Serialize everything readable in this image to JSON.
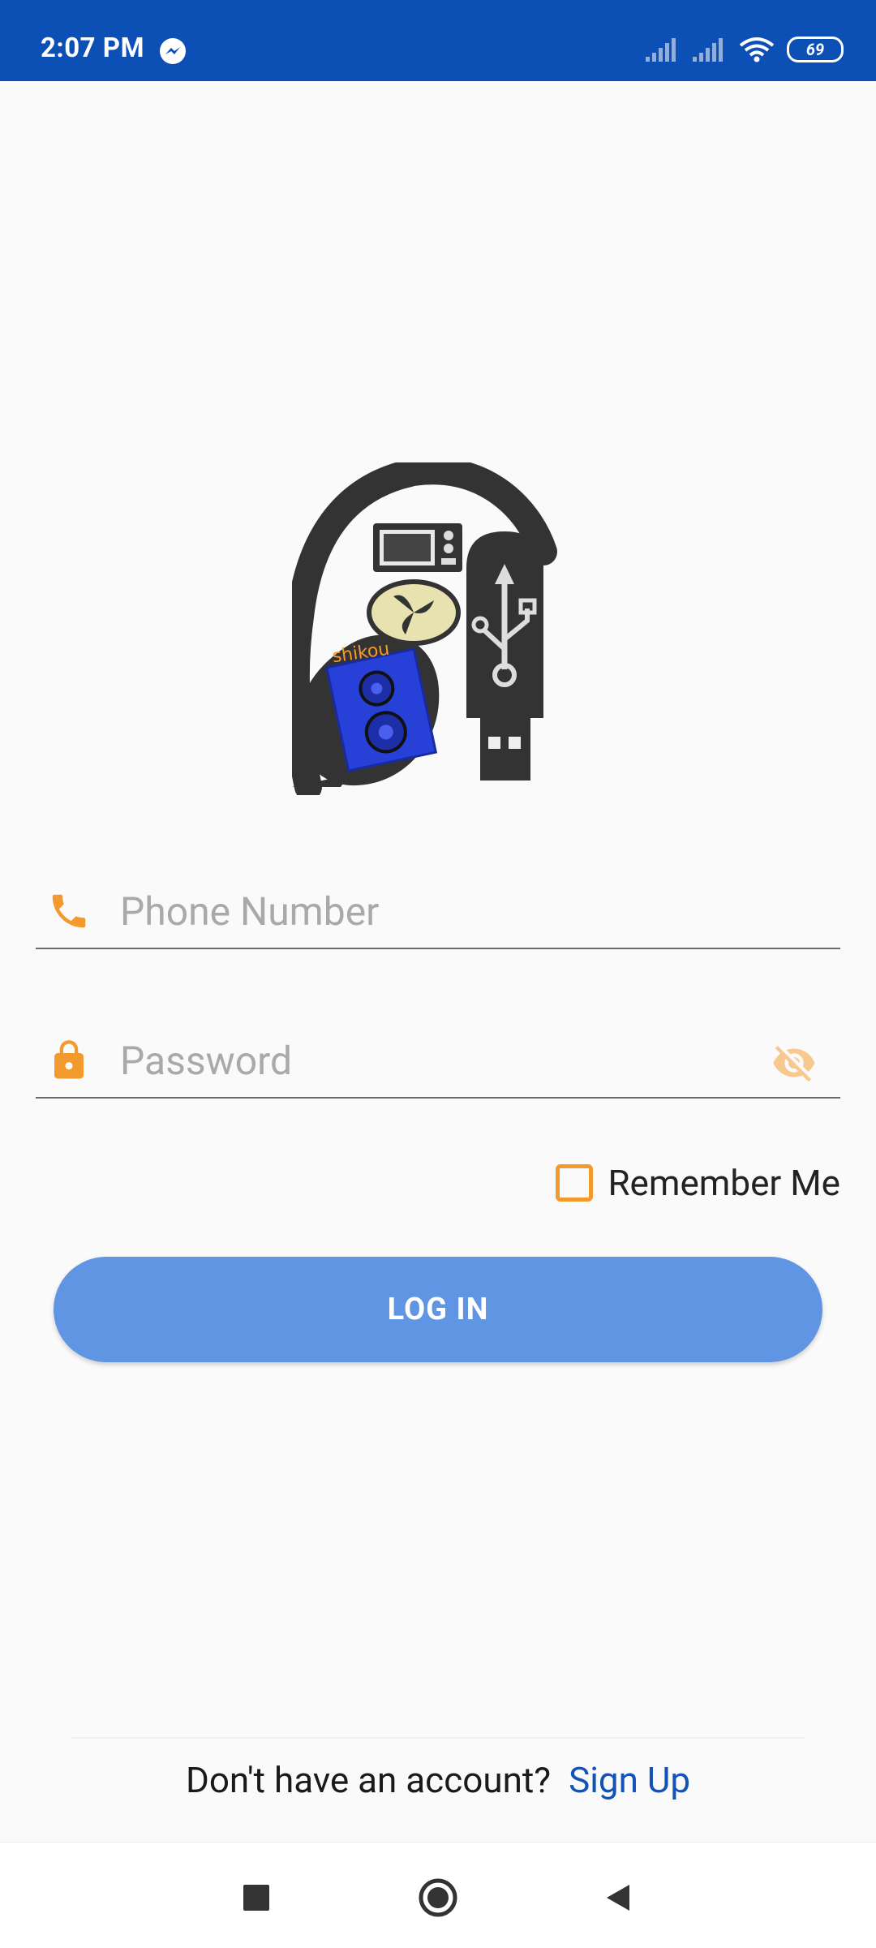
{
  "status_bar": {
    "time": "2:07 PM",
    "battery_level": "69"
  },
  "login_form": {
    "phone_placeholder": "Phone Number",
    "password_placeholder": "Password",
    "remember_label": "Remember Me",
    "login_label": "LOG IN"
  },
  "signup": {
    "prompt": "Don't have an account?",
    "link_label": "Sign Up"
  },
  "logo": {
    "brand_text": "shikou"
  },
  "colors": {
    "status_bar": "#0c4fb5",
    "accent_orange": "#f29a2e",
    "button": "#5f95e3",
    "link": "#1452b5",
    "background": "#fafafa"
  },
  "icons": {
    "messenger": "messenger-icon",
    "signal": "signal-icon",
    "wifi": "wifi-icon",
    "battery": "battery-icon",
    "phone": "phone-icon",
    "lock": "lock-icon",
    "visibility_off": "eye-off-icon",
    "nav_recent": "square-icon",
    "nav_home": "circle-icon",
    "nav_back": "triangle-back-icon"
  }
}
